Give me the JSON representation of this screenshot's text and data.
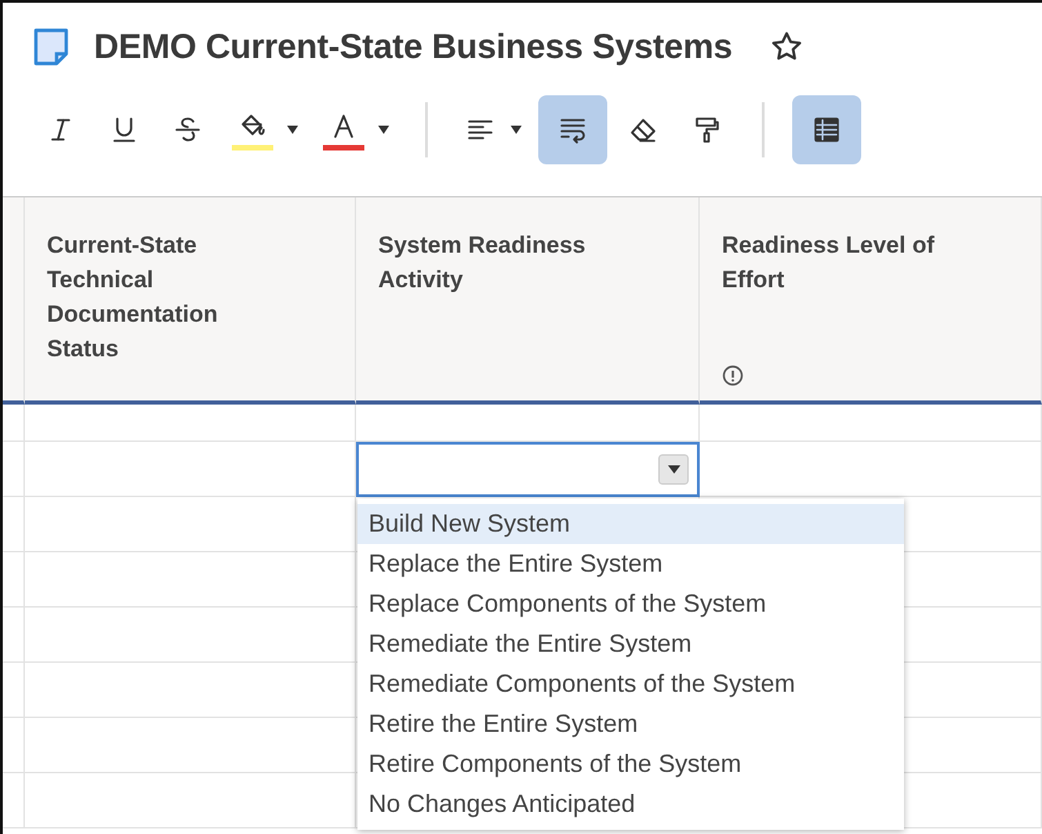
{
  "title": "DEMO Current-State Business Systems",
  "favorite": false,
  "toolbar": [
    {
      "kind": "italic",
      "active": false,
      "dropdown": false
    },
    {
      "kind": "underline",
      "active": false,
      "dropdown": false
    },
    {
      "kind": "strikethrough",
      "active": false,
      "dropdown": false
    },
    {
      "kind": "fill",
      "active": false,
      "dropdown": true,
      "color": "#fff176"
    },
    {
      "kind": "textcolor",
      "active": false,
      "dropdown": true,
      "color": "#e53935"
    },
    {
      "kind": "separator"
    },
    {
      "kind": "align",
      "active": false,
      "dropdown": true
    },
    {
      "kind": "wrap",
      "active": true,
      "dropdown": false
    },
    {
      "kind": "eraser",
      "active": false,
      "dropdown": false
    },
    {
      "kind": "painter",
      "active": false,
      "dropdown": false
    },
    {
      "kind": "separator"
    },
    {
      "kind": "grid",
      "active": true,
      "dropdown": false
    }
  ],
  "columns": [
    {
      "header": "Current-State Technical Documentation Status",
      "info": false
    },
    {
      "header": "System Readiness Activity",
      "info": false
    },
    {
      "header": "Readiness Level of Effort",
      "info": true
    }
  ],
  "dropdown": {
    "options": [
      {
        "label": "Build New System",
        "selected": true
      },
      {
        "label": "Replace the Entire System",
        "selected": false
      },
      {
        "label": "Replace Components of the System",
        "selected": false
      },
      {
        "label": "Remediate the Entire System",
        "selected": false
      },
      {
        "label": "Remediate Components of the System",
        "selected": false
      },
      {
        "label": "Retire the Entire System",
        "selected": false
      },
      {
        "label": "Retire Components of the System",
        "selected": false
      },
      {
        "label": "No Changes Anticipated",
        "selected": false
      }
    ]
  }
}
